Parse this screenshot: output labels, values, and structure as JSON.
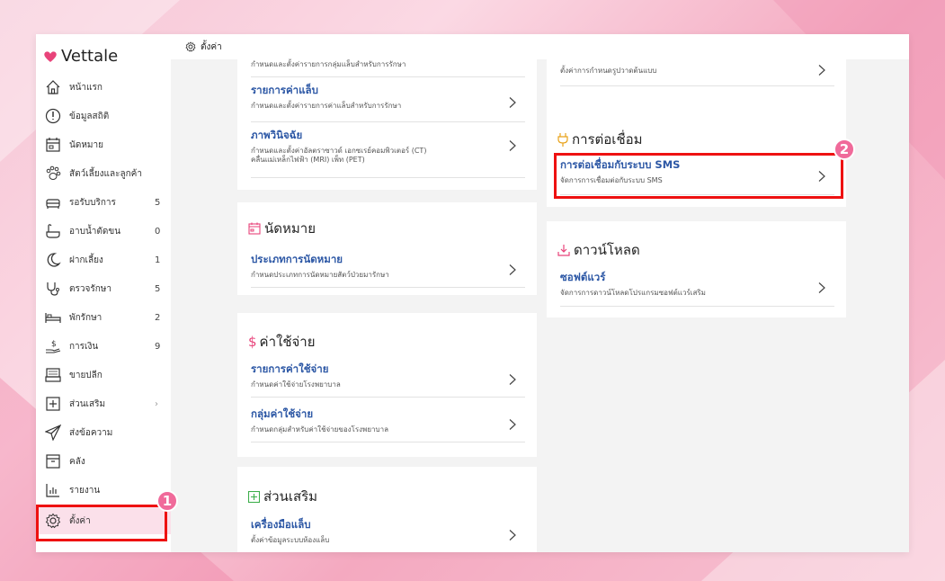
{
  "sidebar": {
    "brand": "Vettale",
    "items": [
      {
        "label": "หน้าแรก",
        "count": ""
      },
      {
        "label": "ข้อมูลสถิติ",
        "count": ""
      },
      {
        "label": "นัดหมาย",
        "count": ""
      },
      {
        "label": "สัตว์เลี้ยงและลูกค้า",
        "count": ""
      },
      {
        "label": "รอรับบริการ",
        "count": "5"
      },
      {
        "label": "อาบน้ำตัดขน",
        "count": "0"
      },
      {
        "label": "ฝากเลี้ยง",
        "count": "1"
      },
      {
        "label": "ตรวจรักษา",
        "count": "5"
      },
      {
        "label": "พักรักษา",
        "count": "2"
      },
      {
        "label": "การเงิน",
        "count": "9"
      },
      {
        "label": "ขายปลีก",
        "count": ""
      },
      {
        "label": "ส่วนเสริม",
        "count": "›"
      },
      {
        "label": "ส่งข้อความ",
        "count": ""
      },
      {
        "label": "คลัง",
        "count": ""
      },
      {
        "label": "รายงาน",
        "count": ""
      },
      {
        "label": "ตั้งค่า",
        "count": ""
      }
    ]
  },
  "header": {
    "title": "ตั้งค่า"
  },
  "annotations": {
    "badge1": "1",
    "badge2": "2"
  },
  "cards": {
    "lab": {
      "top_desc": "กำหนดและตั้งค่ารายการกลุ่มแล็บสำหรับการรักษา",
      "rows": [
        {
          "title": "รายการค่าแล็บ",
          "desc": "กำหนดและตั้งค่ารายการค่าแล็บสำหรับการรักษา"
        },
        {
          "title": "ภาพวินิจฉัย",
          "desc": "กำหนดและตั้งค่าอัลตราซาวด์ เอกซเรย์คอมพิวเตอร์ (CT)",
          "desc2": "คลื่นแม่เหล็กไฟฟ้า (MRI) เพ็ท (PET)"
        }
      ]
    },
    "appointment": {
      "title": "นัดหมาย",
      "rows": [
        {
          "title": "ประเภทการนัดหมาย",
          "desc": "กำหนดประเภทการนัดหมายสัตว์ป่วยมารักษา"
        }
      ]
    },
    "expense": {
      "title": "ค่าใช้จ่าย",
      "rows": [
        {
          "title": "รายการค่าใช้จ่าย",
          "desc": "กำหนดค่าใช้จ่ายโรงพยาบาล"
        },
        {
          "title": "กลุ่มค่าใช้จ่าย",
          "desc": "กำหนดกลุ่มสำหรับค่าใช้จ่ายของโรงพยาบาล"
        }
      ]
    },
    "addon": {
      "title": "ส่วนเสริม",
      "rows": [
        {
          "title": "เครื่องมือแล็บ",
          "desc": "ตั้งค่าข้อมูลระบบห้องแล็บ"
        }
      ]
    },
    "template": {
      "desc": "ตั้งค่าการกำหนดรูปวาดต้นแบบ"
    },
    "connect": {
      "title": "การต่อเชื่อม",
      "rows": [
        {
          "title": "การต่อเชื่อมกับระบบ SMS",
          "desc": "จัดการการเชื่อมต่อกับระบบ SMS"
        }
      ]
    },
    "download": {
      "title": "ดาวน์โหลด",
      "rows": [
        {
          "title": "ซอฟต์แวร์",
          "desc": "จัดการการดาวน์โหลดโปรแกรมซอฟต์แวร์เสริม"
        }
      ]
    }
  },
  "colors": {
    "accent": "#f06a9a",
    "link": "#2c57a5",
    "highlight": "#e11111"
  }
}
